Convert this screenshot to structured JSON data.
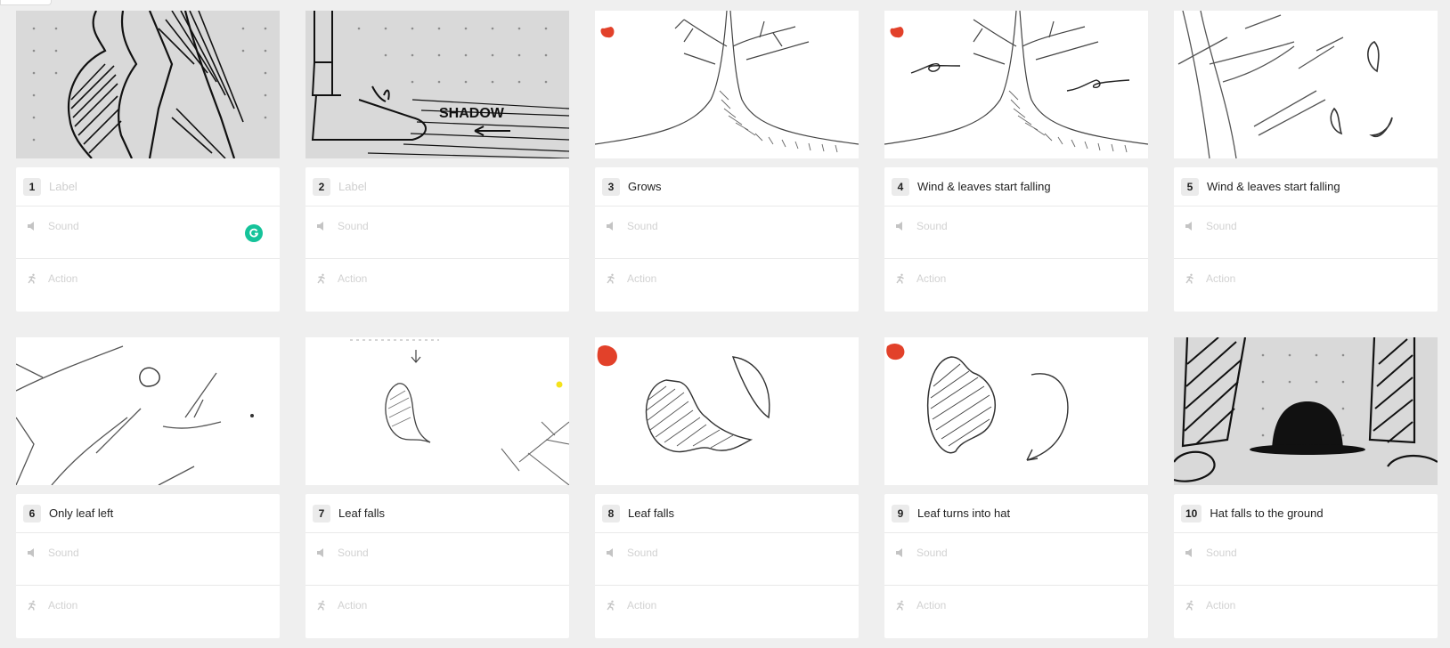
{
  "sound_placeholder": "Sound",
  "action_placeholder": "Action",
  "frames": [
    {
      "number": "1",
      "label": "Label",
      "label_is_placeholder": true,
      "image": "tree-trunk-closeup-sketch"
    },
    {
      "number": "2",
      "label": "Label",
      "label_is_placeholder": true,
      "image": "feet-with-shadow-sketch",
      "image_text": "SHADOW"
    },
    {
      "number": "3",
      "label": "Grows",
      "label_is_placeholder": false,
      "image": "tree-sketch"
    },
    {
      "number": "4",
      "label": "Wind & leaves start falling",
      "label_is_placeholder": false,
      "image": "tree-with-wind-sketch"
    },
    {
      "number": "5",
      "label": "Wind & leaves start falling",
      "label_is_placeholder": false,
      "image": "branches-with-leaves-sketch"
    },
    {
      "number": "6",
      "label": "Only leaf left",
      "label_is_placeholder": false,
      "image": "bare-branches-sketch"
    },
    {
      "number": "7",
      "label": "Leaf falls",
      "label_is_placeholder": false,
      "image": "single-leaf-sketch"
    },
    {
      "number": "8",
      "label": "Leaf falls",
      "label_is_placeholder": false,
      "image": "curled-leaf-sketch"
    },
    {
      "number": "9",
      "label": "Leaf turns into hat",
      "label_is_placeholder": false,
      "image": "leaf-to-hat-sketch"
    },
    {
      "number": "10",
      "label": "Hat falls to the ground",
      "label_is_placeholder": false,
      "image": "hat-on-ground-sketch"
    }
  ],
  "colors": {
    "grammarly": "#15c39a",
    "red_marker": "#e2412a",
    "yellow_marker": "#f5e21b"
  }
}
